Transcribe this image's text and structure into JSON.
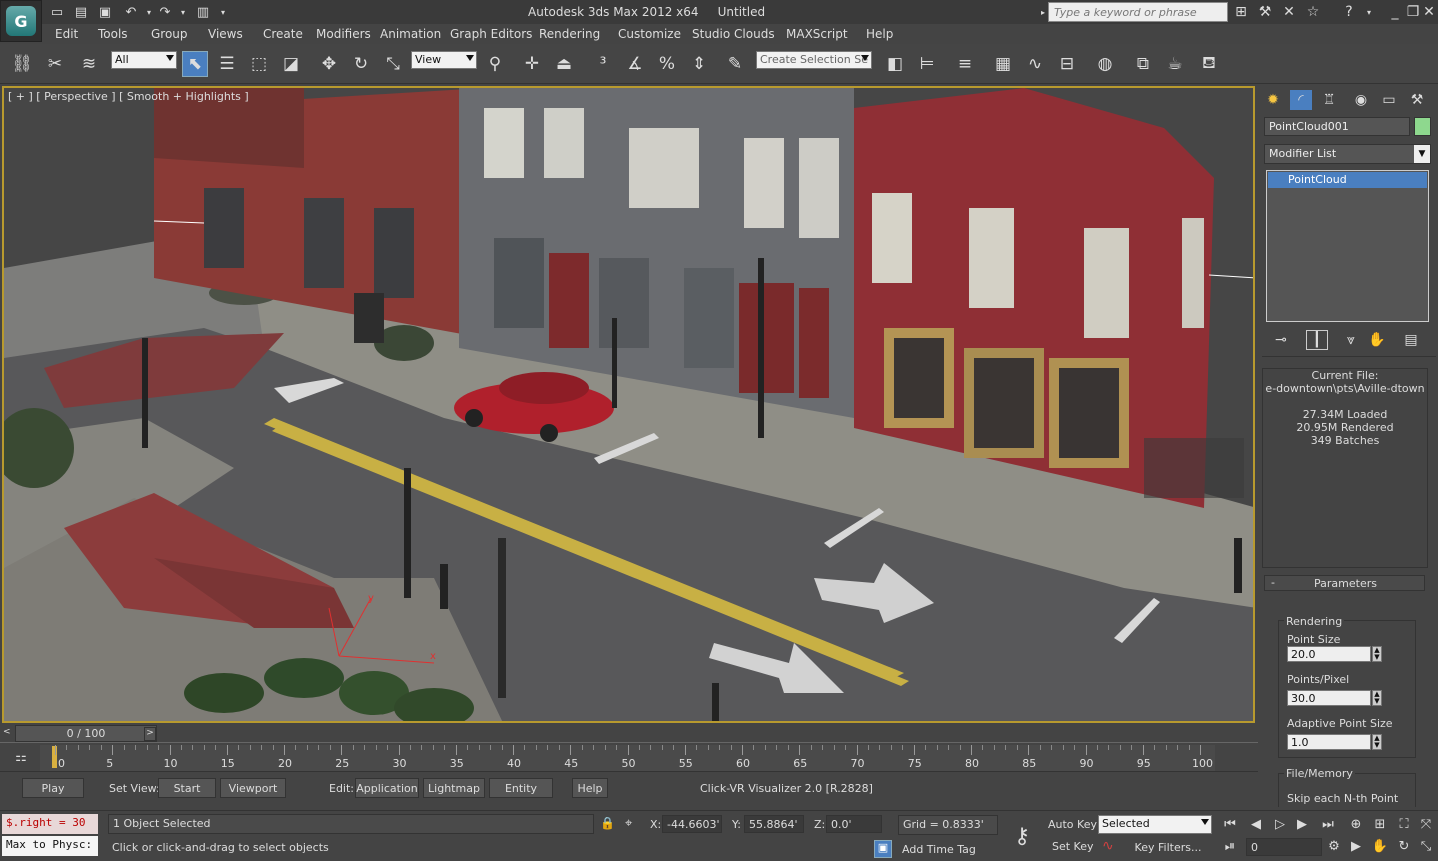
{
  "titlebar": {
    "app_title": "Autodesk 3ds Max  2012 x64",
    "doc_title": "Untitled",
    "search_placeholder": "Type a keyword or phrase"
  },
  "menu": [
    "Edit",
    "Tools",
    "Group",
    "Views",
    "Create",
    "Modifiers",
    "Animation",
    "Graph Editors",
    "Rendering",
    "Customize",
    "Studio Clouds",
    "MAXScript",
    "Help"
  ],
  "toolbar": {
    "selection_filter": "All",
    "ref_coord": "View",
    "named_selection": "Create Selection Se"
  },
  "viewport": {
    "label": "[ + ] [ Perspective ] [ Smooth + Highlights ]",
    "axis_x": "x",
    "axis_y": "y"
  },
  "command_panel": {
    "object_name": "PointCloud001",
    "object_color": "#8ed88e",
    "modifier_list": "Modifier List",
    "stack_item": "PointCloud",
    "current_file_label": "Current File:",
    "current_file_path": "e-downtown\\pts\\Aville-dtown",
    "loaded": "27.34M Loaded",
    "rendered": "20.95M Rendered",
    "batches": "349 Batches",
    "rollout_title": "Parameters",
    "rendering_group": "Rendering",
    "point_size_label": "Point Size",
    "point_size": "20.0",
    "points_pixel_label": "Points/Pixel",
    "points_pixel": "30.0",
    "adaptive_label": "Adaptive Point Size",
    "adaptive": "1.0",
    "file_memory_group": "File/Memory",
    "skip_label": "Skip each N-th Point"
  },
  "timeline": {
    "slider": "0 / 100",
    "frame_current": 0,
    "frame_max": 100,
    "ticks": [
      "0",
      "5",
      "10",
      "15",
      "20",
      "25",
      "30",
      "35",
      "40",
      "45",
      "50",
      "55",
      "60",
      "65",
      "70",
      "75",
      "80",
      "85",
      "90",
      "95",
      "100"
    ]
  },
  "plugin_bar": {
    "play": "Play",
    "set_view_label": "Set View:",
    "start": "Start",
    "viewport": "Viewport",
    "edit_label": "Edit:",
    "application": "Application",
    "lightmap": "Lightmap",
    "entity": "Entity",
    "help": "Help",
    "version": "Click-VR Visualizer 2.0 [R.2828]"
  },
  "status": {
    "maxscript_line1": "$.right = 30",
    "maxscript_line2": "Max to Physc:",
    "selection": "1 Object Selected",
    "prompt": "Click or click-and-drag to select objects",
    "x_label": "X:",
    "x": "-44.6603'",
    "y_label": "Y:",
    "y": "55.8864'",
    "z_label": "Z:",
    "z": "0.0'",
    "grid": "Grid = 0.8333'",
    "add_time_tag": "Add Time Tag",
    "auto_key": "Auto Key",
    "set_key": "Set Key",
    "key_mode": "Selected",
    "key_filters": "Key Filters...",
    "frame_field": "0"
  }
}
